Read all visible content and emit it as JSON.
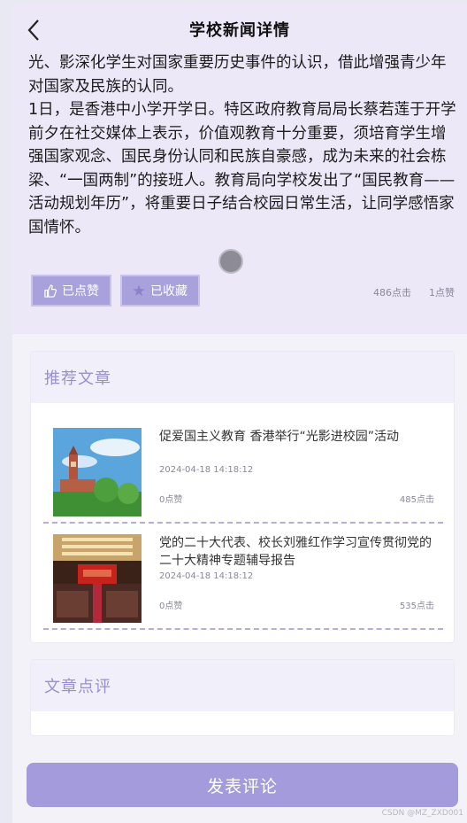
{
  "header": {
    "title": "学校新闻详情"
  },
  "article": {
    "paragraphs": [
      "光、影深化学生对国家重要历史事件的认识，借此增强青少年对国家及民族的认同。",
      "1日，是香港中小学开学日。特区政府教育局局长蔡若莲于开学前夕在社交媒体上表示，价值观教育十分重要，须培育学生增强国家观念、国民身份认同和民族自豪感，成为未来的社会栋梁、“一国两制”的接班人。教育局向学校发出了“国民教育——活动规划年历”，将重要日子结合校园日常生活，让同学感悟家国情怀。"
    ],
    "like_label": "已点赞",
    "fav_label": "已收藏",
    "clicks": "486点击",
    "likes": "1点赞"
  },
  "recommend": {
    "heading": "推荐文章",
    "items": [
      {
        "title": "促爱国主义教育 香港举行“光影进校园”活动",
        "date": "2024-04-18 14:18:12",
        "likes": "0点赞",
        "clicks": "485点击"
      },
      {
        "title": "党的二十大代表、校长刘雅红作学习宣传贯彻党的二十大精神专题辅导报告",
        "date": "2024-04-18 14:18:12",
        "likes": "0点赞",
        "clicks": "535点击"
      }
    ]
  },
  "comments": {
    "heading": "文章点评"
  },
  "submit_label": "发表评论",
  "watermark": "CSDN @MZ_ZXD001",
  "colors": {
    "accent": "#a49bdd",
    "header_bg": "#ece8f8",
    "dash": "#b6acdf"
  }
}
